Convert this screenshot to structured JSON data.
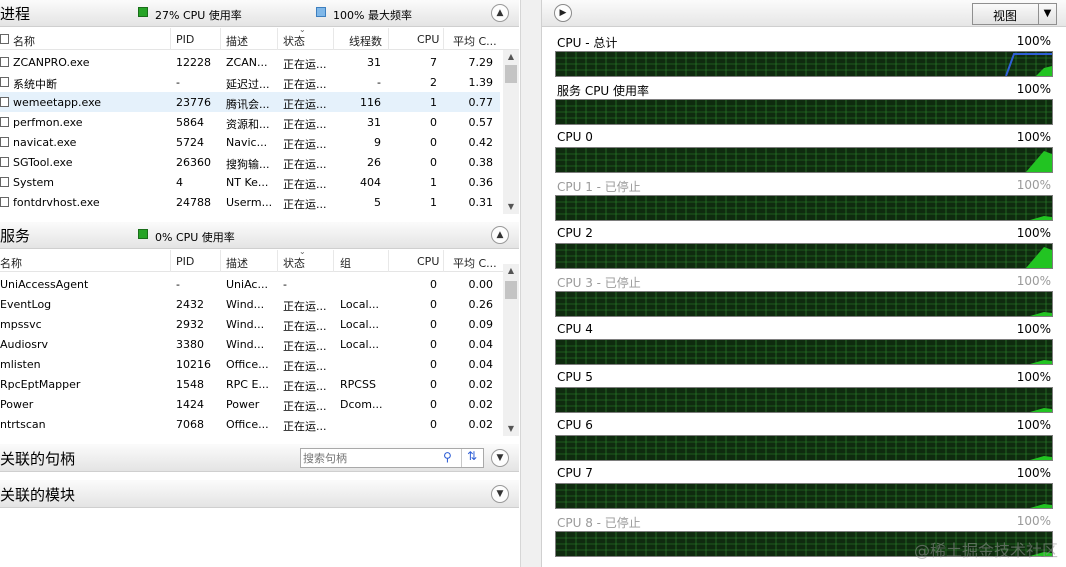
{
  "processes": {
    "title": "进程",
    "summary": [
      {
        "text": "27% CPU 使用率",
        "icon": "cpu-usage-square-icon",
        "color": "#27a427"
      },
      {
        "text": "100% 最大频率",
        "icon": "max-frequency-square-icon",
        "color": "#7fb7e8"
      }
    ],
    "columns": [
      "名称",
      "PID",
      "描述",
      "状态",
      "线程数",
      "CPU",
      "平均 C..."
    ],
    "rows": [
      [
        "ZCANPRO.exe",
        "12228",
        "ZCAN...",
        "正在运...",
        "31",
        "7",
        "7.29"
      ],
      [
        "系统中断",
        "-",
        "延迟过...",
        "正在运...",
        "-",
        "2",
        "1.39"
      ],
      [
        "wemeetapp.exe",
        "23776",
        "腾讯会...",
        "正在运...",
        "116",
        "1",
        "0.77"
      ],
      [
        "perfmon.exe",
        "5864",
        "资源和...",
        "正在运...",
        "31",
        "0",
        "0.57"
      ],
      [
        "navicat.exe",
        "5724",
        "Navic...",
        "正在运...",
        "9",
        "0",
        "0.42"
      ],
      [
        "SGTool.exe",
        "26360",
        "搜狗输...",
        "正在运...",
        "26",
        "0",
        "0.38"
      ],
      [
        "System",
        "4",
        "NT Ke...",
        "正在运...",
        "404",
        "1",
        "0.36"
      ],
      [
        "fontdrvhost.exe",
        "24788",
        "Userm...",
        "正在运...",
        "5",
        "1",
        "0.31"
      ]
    ]
  },
  "services": {
    "title": "服务",
    "summary": [
      {
        "text": "0% CPU 使用率",
        "icon": "cpu-usage-square-icon",
        "color": "#27a427"
      }
    ],
    "columns": [
      "名称",
      "PID",
      "描述",
      "状态",
      "组",
      "CPU",
      "平均 C..."
    ],
    "rows": [
      [
        "UniAccessAgent",
        "-",
        "UniAc...",
        "-",
        "",
        "0",
        "0.00"
      ],
      [
        "EventLog",
        "2432",
        "Wind...",
        "正在运...",
        "Local...",
        "0",
        "0.26"
      ],
      [
        "mpssvc",
        "2932",
        "Wind...",
        "正在运...",
        "Local...",
        "0",
        "0.09"
      ],
      [
        "Audiosrv",
        "3380",
        "Wind...",
        "正在运...",
        "Local...",
        "0",
        "0.04"
      ],
      [
        "mlisten",
        "10216",
        "Office...",
        "正在运...",
        "",
        "0",
        "0.04"
      ],
      [
        "RpcEptMapper",
        "1548",
        "RPC E...",
        "正在运...",
        "RPCSS",
        "0",
        "0.02"
      ],
      [
        "Power",
        "1424",
        "Power",
        "正在运...",
        "Dcom...",
        "0",
        "0.02"
      ],
      [
        "ntrtscan",
        "7068",
        "Office...",
        "正在运...",
        "",
        "0",
        "0.02"
      ]
    ]
  },
  "handles": {
    "title": "关联的句柄",
    "search_placeholder": "搜索句柄"
  },
  "modules": {
    "title": "关联的模块"
  },
  "right_panel": {
    "view_label": "视图",
    "cpus": [
      {
        "label": "CPU - 总计",
        "pct": "100%",
        "stopped": false
      },
      {
        "label": "服务 CPU 使用率",
        "pct": "100%",
        "stopped": false
      },
      {
        "label": "CPU 0",
        "pct": "100%",
        "stopped": false
      },
      {
        "label": "CPU 1 - 已停止",
        "pct": "100%",
        "stopped": true
      },
      {
        "label": "CPU 2",
        "pct": "100%",
        "stopped": false
      },
      {
        "label": "CPU 3 - 已停止",
        "pct": "100%",
        "stopped": true
      },
      {
        "label": "CPU 4",
        "pct": "100%",
        "stopped": false
      },
      {
        "label": "CPU 5",
        "pct": "100%",
        "stopped": false
      },
      {
        "label": "CPU 6",
        "pct": "100%",
        "stopped": false
      },
      {
        "label": "CPU 7",
        "pct": "100%",
        "stopped": false
      },
      {
        "label": "CPU 8 - 已停止",
        "pct": "100%",
        "stopped": true
      }
    ]
  },
  "watermark": "@稀土掘金技术社区",
  "colors": {
    "graph_bg": "#0f2b0f",
    "graph_grid": "#2e8b2e",
    "graph_fill": "#22c422",
    "graph_line_blue": "#2f5fd6",
    "row_selected": "#e5f1fb"
  }
}
